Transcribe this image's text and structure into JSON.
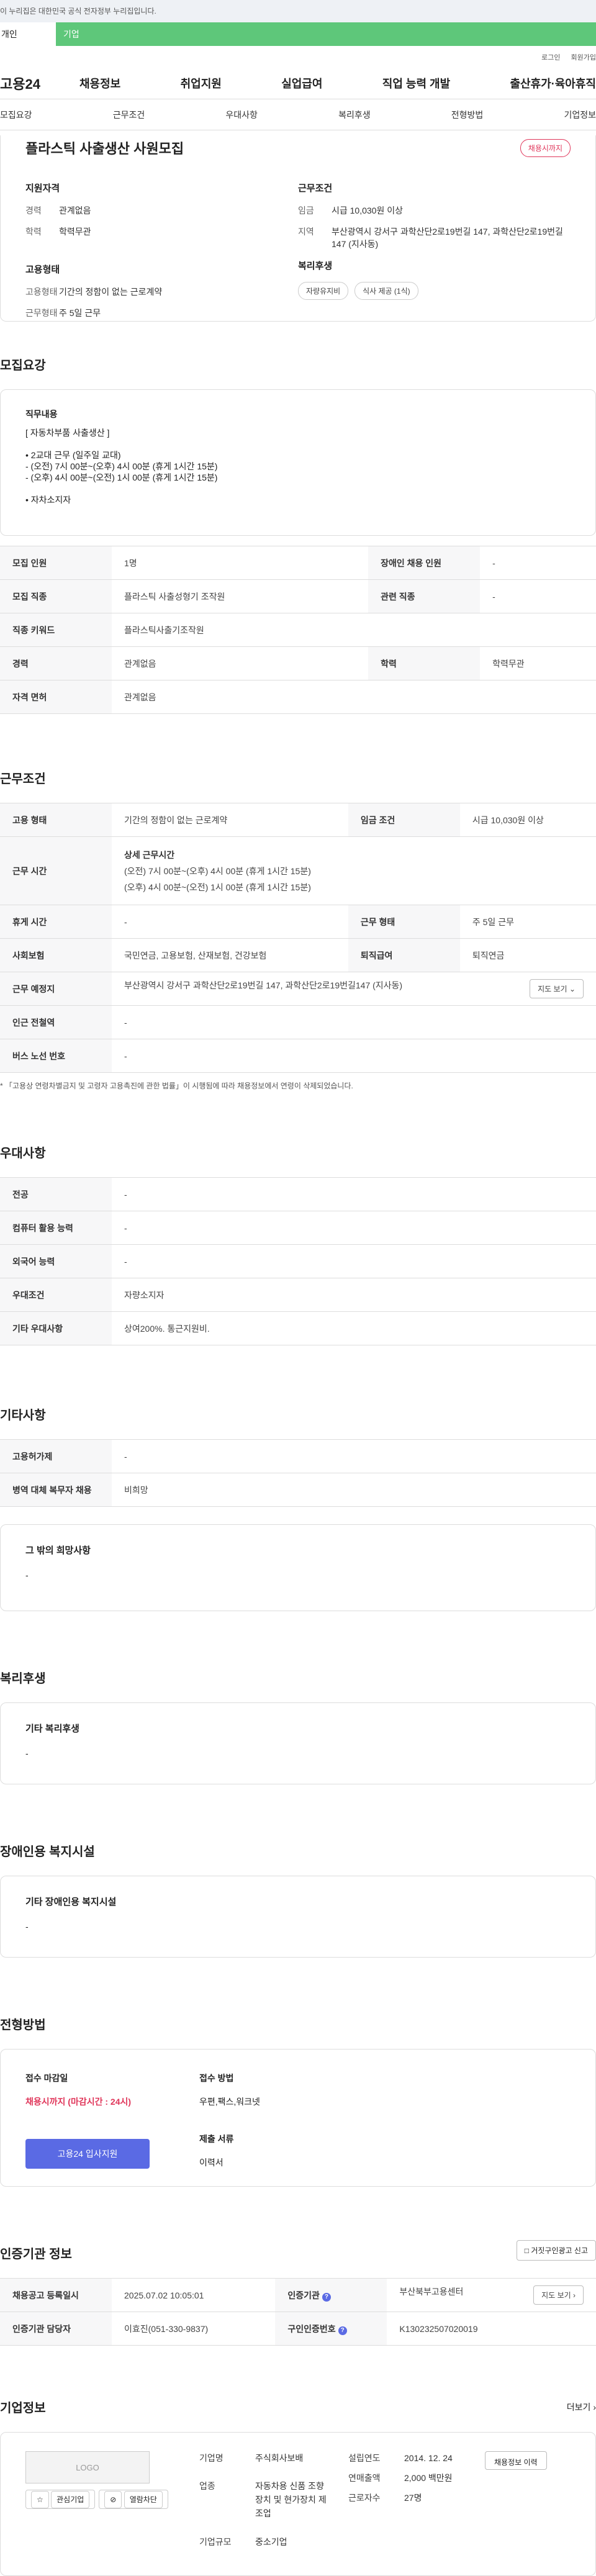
{
  "gov_banner": "이 누리집은 대한민국 공식 전자정부 누리집입니다.",
  "usertype": {
    "individual": "개인",
    "company": "기업"
  },
  "util": {
    "login": "로그인",
    "join": "회원가입"
  },
  "gnb": {
    "logo": "고용24",
    "menu": [
      "채용정보",
      "취업지원",
      "실업급여",
      "직업 능력 개발",
      "출산휴가·육아휴직"
    ]
  },
  "subtabs": [
    "모집요강",
    "근무조건",
    "우대사항",
    "복리후생",
    "전형방법",
    "기업정보"
  ],
  "summary": {
    "title": "플라스틱 사출생산 사원모집",
    "badge": "채용시까지",
    "qual_label": "지원자격",
    "career_k": "경력",
    "career_v": "관계없음",
    "edu_k": "학력",
    "edu_v": "학력무관",
    "emp_label": "고용형태",
    "emptype_k": "고용형태",
    "emptype_v": "기간의 정함이 없는 근로계약",
    "workform_k": "근무형태",
    "workform_v": "주 5일 근무",
    "cond_label": "근무조건",
    "wage_k": "임금",
    "wage_v": "시급 10,030원 이상",
    "region_k": "지역",
    "region_v": "부산광역시 강서구 과학산단2로19번길 147, 과학산단2로19번길147 (지사동)",
    "welfare_label": "복리후생",
    "welfare_tags": [
      "자량유지비",
      "식사 제공 (1식)"
    ]
  },
  "recruit": {
    "heading": "모집요강",
    "job_label": "직무내용",
    "job_lines": [
      "[ 자동차부품 사출생산 ]",
      "",
      "• 2교대 근무 (일주일 교대)",
      "- (오전) 7시 00분~(오후) 4시 00분 (휴게 1시간 15분)",
      "- (오후) 4시 00분~(오전) 1시 00분 (휴게 1시간 15분)",
      "",
      "• 자차소지자"
    ],
    "rows": [
      {
        "k1": "모집 인원",
        "v1": "1명",
        "k2": "장애인 채용 인원",
        "v2": "-"
      },
      {
        "k1": "모집 직종",
        "v1": "플라스틱 사출성형기 조작원",
        "k2": "관련 직종",
        "v2": "-"
      },
      {
        "k1": "직종 키워드",
        "v1": "플라스틱사출기조작원"
      },
      {
        "k1": "경력",
        "v1": "관계없음",
        "k2": "학력",
        "v2": "학력무관"
      },
      {
        "k1": "자격 면허",
        "v1": "관계없음"
      }
    ]
  },
  "work": {
    "heading": "근무조건",
    "emp_k": "고용 형태",
    "emp_v": "기간의 정함이 없는 근로계약",
    "wage_k": "임금 조건",
    "wage_v": "시급 10,030원 이상",
    "time_k": "근무 시간",
    "time_detail_label": "상세 근무시간",
    "time_lines": [
      "(오전) 7시 00분~(오후) 4시 00분 (휴게 1시간 15분)",
      "(오후) 4시 00분~(오전) 1시 00분 (휴게 1시간 15분)"
    ],
    "rest_k": "휴게 시간",
    "rest_v": "-",
    "form_k": "근무 형태",
    "form_v": "주 5일 근무",
    "ins_k": "사회보험",
    "ins_v": "국민연금, 고용보험, 산재보험, 건강보험",
    "ret_k": "퇴직급여",
    "ret_v": "퇴직연금",
    "place_k": "근무 예정지",
    "place_v": "부산광역시 강서구 과학산단2로19번길 147, 과학산단2로19번길147 (지사동)",
    "map_btn": "지도 보기",
    "subway_k": "인근 전철역",
    "subway_v": "-",
    "bus_k": "버스 노선 번호",
    "bus_v": "-",
    "note": "「고용상 연령차별금지 및 고령자 고용촉진에 관한 법률」이 시행됨에 따라 채용정보에서 연령이 삭제되었습니다."
  },
  "prefer": {
    "heading": "우대사항",
    "rows": [
      {
        "k": "전공",
        "v": "-"
      },
      {
        "k": "컴퓨터 활용 능력",
        "v": "-"
      },
      {
        "k": "외국어 능력",
        "v": "-"
      },
      {
        "k": "우대조건",
        "v": "자량소지자"
      },
      {
        "k": "기타 우대사항",
        "v": "상여200%. 통근지원비."
      }
    ]
  },
  "etc": {
    "heading": "기타사항",
    "rows": [
      {
        "k": "고용허가제",
        "v": "-"
      },
      {
        "k": "병역 대체 복무자 채용",
        "v": "비희망"
      }
    ],
    "hope_label": "그 밖의 희망사항",
    "hope_v": "-"
  },
  "welfare": {
    "heading": "복리후생",
    "label": "기타 복리후생",
    "v": "-"
  },
  "disabled": {
    "heading": "장애인용 복지시설",
    "label": "기타 장애인용 복지시설",
    "v": "-"
  },
  "selection": {
    "heading": "전형방법",
    "deadline_label": "접수 마감일",
    "deadline_v": "채용시까지 (마감시간 : 24시)",
    "apply_btn": "고용24 입사지원",
    "method_label": "접수 방법",
    "method_v": "우편,팩스,워크넷",
    "docs_label": "제출 서류",
    "docs_v": "이력서"
  },
  "auth": {
    "heading": "인증기관 정보",
    "report_btn": "거짓구인광고 신고",
    "reg_k": "채용공고 등록일시",
    "reg_v": "2025.07.02 10:05:01",
    "org_k": "인증기관",
    "org_v": "부산북부고용센터",
    "map_btn": "지도 보기",
    "mgr_k": "인증기관 담당자",
    "mgr_v": "이효진(051-330-9837)",
    "no_k": "구인인증번호",
    "no_v": "K130232507020019"
  },
  "company": {
    "heading": "기업정보",
    "more": "더보기",
    "logo": "LOGO",
    "fav_btn": "관심기업",
    "block_btn": "열람차단",
    "name_k": "기업명",
    "name_v": "주식회사보배",
    "ind_k": "업종",
    "ind_v": "자동차용 신품 조향장치 및 현가장치 제조업",
    "size_k": "기업규모",
    "size_v": "중소기업",
    "est_k": "설립연도",
    "est_v": "2014. 12. 24",
    "sales_k": "연매출액",
    "sales_v": "2,000 백만원",
    "emp_k": "근로자수",
    "emp_v": "27명",
    "biz_btn": "채용정보 이력"
  }
}
